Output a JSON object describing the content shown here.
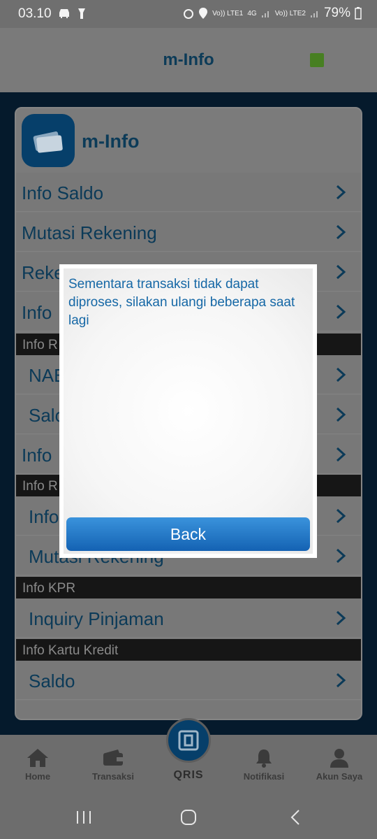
{
  "status_bar": {
    "time": "03.10",
    "battery": "79%",
    "sim1": "Vo)) LTE1",
    "sim2": "Vo)) LTE2",
    "network": "4G"
  },
  "header": {
    "title": "m-Info"
  },
  "card": {
    "title": "m-Info",
    "rows": [
      {
        "label": "Info Saldo"
      },
      {
        "label": "Mutasi Rekening"
      },
      {
        "label": "Reke"
      },
      {
        "label": "Info"
      },
      {
        "label": "NAB"
      },
      {
        "label": "Salo"
      },
      {
        "label": "Info"
      },
      {
        "label": "Info"
      },
      {
        "label": "Mutasi Rekening"
      },
      {
        "label": "Inquiry Pinjaman"
      },
      {
        "label": "Saldo"
      }
    ],
    "sections": [
      {
        "label": "Info R"
      },
      {
        "label": "Info R"
      },
      {
        "label": "Info KPR"
      },
      {
        "label": "Info Kartu Kredit"
      }
    ]
  },
  "dialog": {
    "message": "Sementara transaksi tidak dapat diproses, silakan ulangi beberapa saat lagi",
    "button": "Back"
  },
  "bottom_nav": [
    {
      "label": "Home",
      "icon": "home-icon"
    },
    {
      "label": "Transaksi",
      "icon": "wallet-icon"
    },
    {
      "label": "QRIS",
      "icon": "qris-icon"
    },
    {
      "label": "Notifikasi",
      "icon": "bell-icon"
    },
    {
      "label": "Akun Saya",
      "icon": "user-icon"
    }
  ],
  "colors": {
    "accent": "#1668a6",
    "button": "#2a7cc9",
    "title": "#0c3b58"
  }
}
